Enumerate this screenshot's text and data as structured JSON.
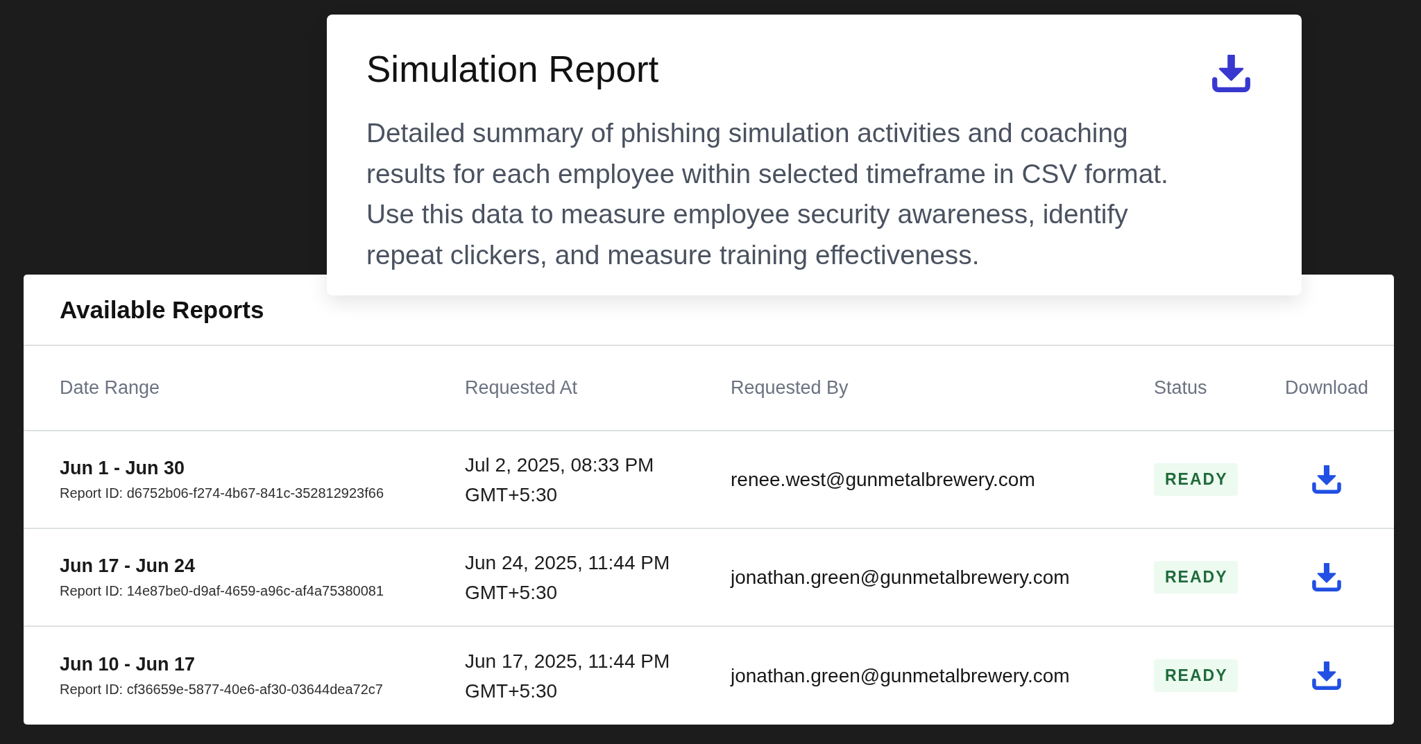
{
  "report_card": {
    "title": "Simulation Report",
    "description": "Detailed summary of phishing simulation activities and coaching results for each employee within selected timeframe in CSV format. Use this data to measure employee security awareness, identify repeat clickers, and measure training effectiveness."
  },
  "available_reports": {
    "title": "Available Reports",
    "columns": [
      "Date Range",
      "Requested At",
      "Requested By",
      "Status",
      "Download"
    ],
    "rows": [
      {
        "date_range": "Jun 1 - Jun 30",
        "report_id": "Report ID: d6752b06-f274-4b67-841c-352812923f66",
        "requested_at": "Jul 2, 2025, 08:33 PM GMT+5:30",
        "requested_by": "renee.west@gunmetalbrewery.com",
        "status": "READY"
      },
      {
        "date_range": "Jun 17 - Jun 24",
        "report_id": "Report ID: 14e87be0-d9af-4659-a96c-af4a75380081",
        "requested_at": "Jun 24, 2025, 11:44 PM GMT+5:30",
        "requested_by": "jonathan.green@gunmetalbrewery.com",
        "status": "READY"
      },
      {
        "date_range": "Jun 10 - Jun 17",
        "report_id": "Report ID: cf36659e-5877-40e6-af30-03644dea72c7",
        "requested_at": "Jun 17, 2025, 11:44 PM GMT+5:30",
        "requested_by": "jonathan.green@gunmetalbrewery.com",
        "status": "READY"
      }
    ]
  }
}
